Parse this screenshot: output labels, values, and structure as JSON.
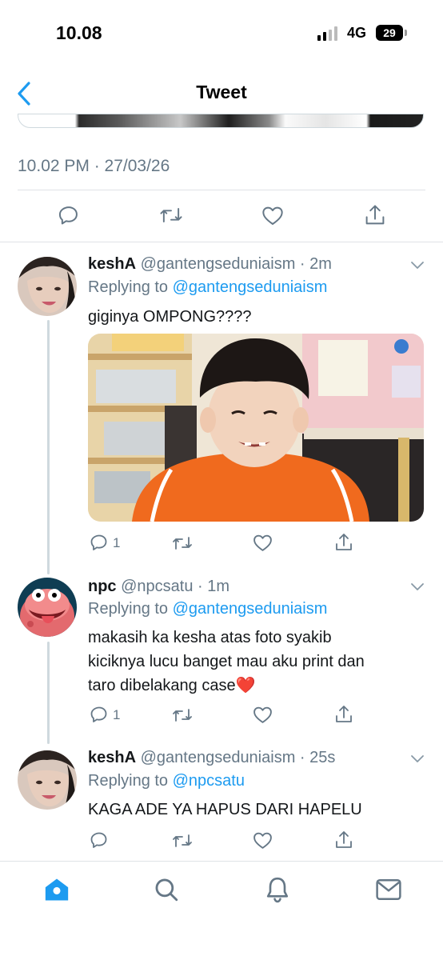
{
  "status_bar": {
    "time": "10.08",
    "network": "4G",
    "battery": "29"
  },
  "nav": {
    "title": "Tweet",
    "back_icon": "chevron-left-icon"
  },
  "main_tweet": {
    "timestamp": "10.02 PM · 27/03/26",
    "actions": [
      "reply-icon",
      "retweet-icon",
      "like-icon",
      "share-icon"
    ]
  },
  "replies": [
    {
      "display_name": "keshA",
      "meta": "@gantengseduniaism · 2m",
      "replying_prefix": "Replying to ",
      "replying_handle": "@gantengseduniaism",
      "text": "giginya OMPONG????",
      "reply_count": "1",
      "has_photo": true
    },
    {
      "display_name": "npc",
      "meta": "@npcsatu · 1m",
      "replying_prefix": "Replying to ",
      "replying_handle": "@gantengseduniaism",
      "text_lines": [
        "makasih ka kesha atas foto syakib",
        "kiciknya lucu banget mau aku print dan",
        "taro dibelakang case❤️"
      ],
      "reply_count": "1"
    },
    {
      "display_name": "keshA",
      "meta": "@gantengseduniaism · 25s",
      "replying_prefix": "Replying to ",
      "replying_handle": "@npcsatu",
      "text": "KAGA ADE YA HAPUS DARI HAPELU",
      "reply_count": ""
    }
  ],
  "tab_bar": [
    "home-icon",
    "search-icon",
    "notifications-icon",
    "messages-icon"
  ],
  "colors": {
    "accent": "#1d9bf0",
    "secondary_text": "#657786",
    "divider": "#dfe3e6"
  }
}
